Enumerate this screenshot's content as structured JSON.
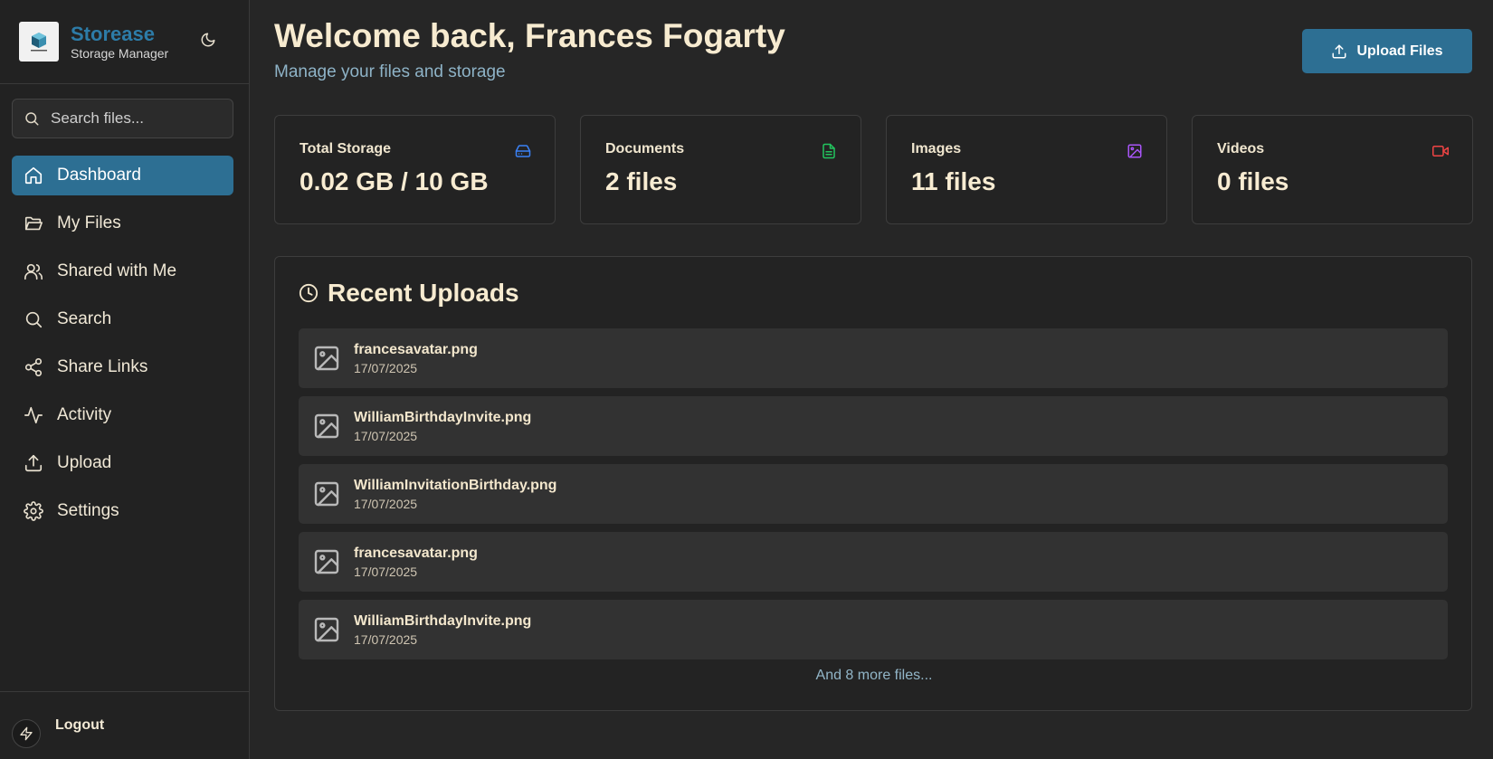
{
  "brand": {
    "name": "Storease",
    "subtitle": "Storage Manager"
  },
  "search": {
    "placeholder": "Search files..."
  },
  "nav": {
    "items": [
      {
        "label": "Dashboard",
        "icon": "home-icon",
        "active": true
      },
      {
        "label": "My Files",
        "icon": "folder-open-icon"
      },
      {
        "label": "Shared with Me",
        "icon": "users-icon"
      },
      {
        "label": "Search",
        "icon": "search-icon"
      },
      {
        "label": "Share Links",
        "icon": "share-icon"
      },
      {
        "label": "Activity",
        "icon": "activity-icon"
      },
      {
        "label": "Upload",
        "icon": "upload-icon"
      },
      {
        "label": "Settings",
        "icon": "gear-icon"
      }
    ]
  },
  "footer": {
    "logout_label": "Logout"
  },
  "header": {
    "welcome": "Welcome back, Frances Fogarty",
    "subtitle": "Manage your files and storage",
    "upload_label": "Upload Files"
  },
  "stats": [
    {
      "title": "Total Storage",
      "value": "0.02 GB / 10 GB",
      "icon": "hard-drive-icon",
      "color": "#3b82f6"
    },
    {
      "title": "Documents",
      "value": "2 files",
      "icon": "document-icon",
      "color": "#22c55e"
    },
    {
      "title": "Images",
      "value": "11 files",
      "icon": "image-icon",
      "color": "#a855f7"
    },
    {
      "title": "Videos",
      "value": "0 files",
      "icon": "video-icon",
      "color": "#ef4444"
    }
  ],
  "recent": {
    "title": "Recent Uploads",
    "files": [
      {
        "name": "francesavatar.png",
        "date": "17/07/2025"
      },
      {
        "name": "WilliamBirthdayInvite.png",
        "date": "17/07/2025"
      },
      {
        "name": "WilliamInvitationBirthday.png",
        "date": "17/07/2025"
      },
      {
        "name": "francesavatar.png",
        "date": "17/07/2025"
      },
      {
        "name": "WilliamBirthdayInvite.png",
        "date": "17/07/2025"
      }
    ],
    "more_label": "And 8 more files..."
  },
  "colors": {
    "accent": "#2d6f93",
    "brand": "#2d7ca8",
    "background": "#262626"
  }
}
